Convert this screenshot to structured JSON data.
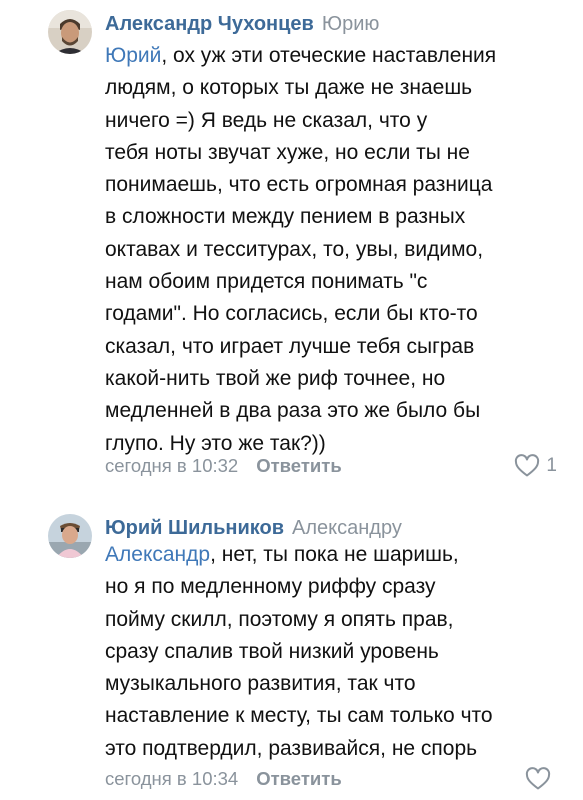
{
  "comments": [
    {
      "author": "Александр Чухонцев",
      "reply_to": "Юрию",
      "mention": "Юрий",
      "text_lines": [
        ", ох уж эти отеческие наставления",
        "людям, о которых ты даже не знаешь",
        "ничего =) Я ведь не сказал, что у",
        "тебя ноты звучат хуже, но если ты не",
        "понимаешь, что есть огромная разница",
        "в сложности между пением в разных",
        "октавах и тесситурах, то, увы, видимо,",
        "нам обоим придется понимать \"с",
        "годами\". Но согласись, если бы кто-то",
        "сказал, что играет лучше тебя сыграв",
        "какой-нить твой же риф точнее, но",
        "медленней в два раза это же было бы",
        "глупо. Ну это же так?))"
      ],
      "time": "сегодня в 10:32",
      "reply_label": "Ответить",
      "like_icon": "heart-outline-icon",
      "like_count": "1"
    },
    {
      "author": "Юрий Шильников",
      "reply_to": "Александру",
      "mention": "Александр",
      "text_lines": [
        ", нет, ты пока не шаришь,",
        "но я по медленному риффу сразу",
        "пойму скилл, поэтому я опять прав,",
        "сразу спалив твой низкий уровень",
        "музыкального развития, так что",
        "наставление к месту, ты сам только что",
        "это подтвердил, развивайся, не спорь"
      ],
      "time": "сегодня в 10:34",
      "reply_label": "Ответить",
      "like_icon": "heart-outline-icon",
      "like_count": ""
    }
  ],
  "colors": {
    "author": "#3d6a98",
    "mention": "#3f78b8",
    "meta": "#8a939c",
    "text": "#111111"
  }
}
